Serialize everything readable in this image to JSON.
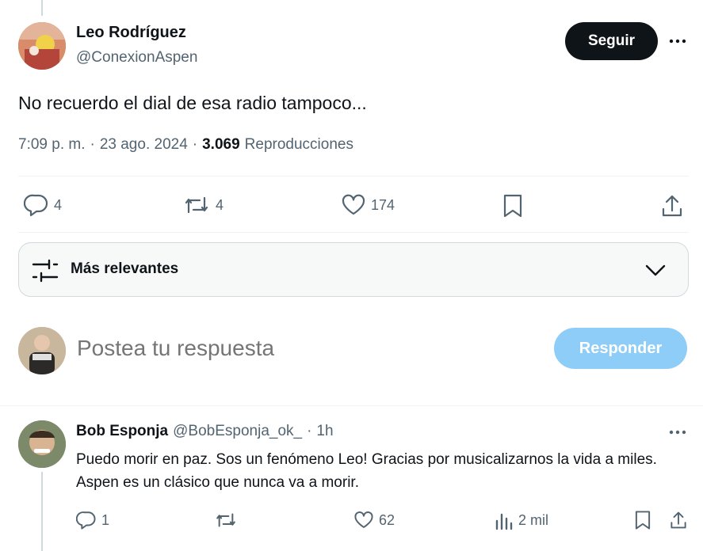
{
  "tweet": {
    "author_name": "Leo Rodríguez",
    "author_handle": "@ConexionAspen",
    "follow_label": "Seguir",
    "text": "No recuerdo el dial de esa radio tampoco...",
    "time": "7:09 p. m.",
    "date": "23 ago. 2024",
    "separator": "·",
    "views_count": "3.069",
    "views_label": "Reproducciones",
    "replies": "4",
    "reposts": "4",
    "likes": "174"
  },
  "sort": {
    "label": "Más relevantes"
  },
  "compose": {
    "placeholder": "Postea tu respuesta",
    "button_label": "Responder"
  },
  "reply": {
    "author_name": "Bob Esponja",
    "author_handle": "@BobEsponja_ok_",
    "separator": "·",
    "time": "1h",
    "text": "Puedo morir en paz. Sos un fenómeno Leo! Gracias por musicalizarnos la vida a miles. Aspen es un clásico que nunca va a morir.",
    "replies": "1",
    "likes": "62",
    "views": "2 mil"
  },
  "colors": {
    "primary_text": "#0f1419",
    "secondary_text": "#536471",
    "follow_bg": "#0f1419",
    "reply_button_disabled": "#8ecdf7",
    "border": "#cfd9de"
  },
  "icons": [
    "more-icon",
    "reply-icon",
    "repost-icon",
    "like-icon",
    "bookmark-icon",
    "share-icon",
    "filter-icon",
    "chevron-down-icon",
    "views-icon"
  ]
}
